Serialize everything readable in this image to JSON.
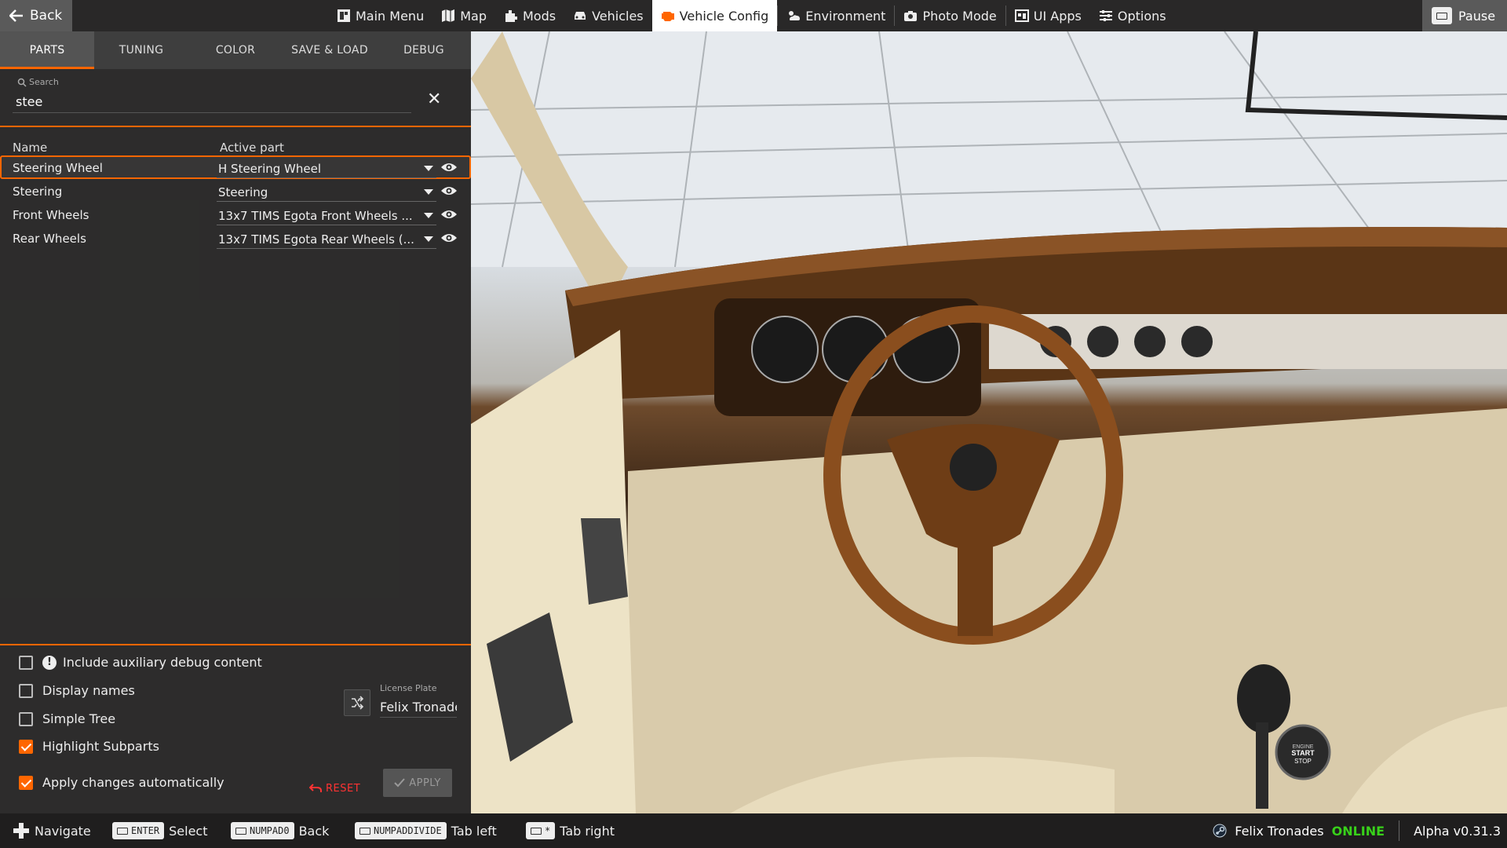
{
  "topbar": {
    "back_label": "Back",
    "nav": [
      {
        "label": "Main Menu",
        "icon": "main-menu-icon"
      },
      {
        "label": "Map",
        "icon": "map-icon"
      },
      {
        "label": "Mods",
        "icon": "mods-icon"
      },
      {
        "label": "Vehicles",
        "icon": "car-icon"
      },
      {
        "label": "Vehicle Config",
        "icon": "engine-icon",
        "active": true
      },
      {
        "label": "Environment",
        "icon": "weather-icon"
      },
      {
        "label": "Photo Mode",
        "icon": "camera-icon"
      },
      {
        "label": "UI Apps",
        "icon": "ui-apps-icon"
      },
      {
        "label": "Options",
        "icon": "sliders-icon"
      }
    ],
    "pause_label": "Pause"
  },
  "panel": {
    "tabs": [
      {
        "label": "PARTS",
        "active": true
      },
      {
        "label": "TUNING"
      },
      {
        "label": "COLOR"
      },
      {
        "label": "SAVE & LOAD"
      },
      {
        "label": "DEBUG"
      }
    ],
    "search": {
      "label": "Search",
      "value": "stee"
    },
    "columns": {
      "name": "Name",
      "active": "Active part"
    },
    "rows": [
      {
        "name": "Steering Wheel",
        "value": "H Steering Wheel",
        "selected": true
      },
      {
        "name": "Steering",
        "value": "Steering"
      },
      {
        "name": "Front Wheels",
        "value": "13x7 TIMS Egota Front Wheels ..."
      },
      {
        "name": "Rear Wheels",
        "value": "13x7 TIMS Egota Rear Wheels (..."
      }
    ],
    "settings": {
      "aux_debug": {
        "label": "Include auxiliary debug content",
        "checked": false
      },
      "display_names": {
        "label": "Display names",
        "checked": false
      },
      "simple_tree": {
        "label": "Simple Tree",
        "checked": false
      },
      "highlight_subparts": {
        "label": "Highlight Subparts",
        "checked": true
      },
      "apply_auto": {
        "label": "Apply changes automatically",
        "checked": true
      }
    },
    "license_plate": {
      "label": "License Plate",
      "value": "Felix Tronade"
    },
    "reset_label": "RESET",
    "apply_label": "APPLY"
  },
  "bottombar": {
    "hints": [
      {
        "key": "",
        "label": "Navigate"
      },
      {
        "key": "ENTER",
        "label": "Select"
      },
      {
        "key": "NUMPAD0",
        "label": "Back"
      },
      {
        "key": "NUMPADDIVIDE",
        "label": "Tab left"
      },
      {
        "key": "*",
        "label": "Tab right"
      }
    ],
    "user": "Felix Tronades",
    "status": "ONLINE",
    "version": "Alpha v0.31.3"
  },
  "scene": {
    "start_stop_lines": [
      "ENGINE",
      "START",
      "STOP"
    ]
  },
  "colors": {
    "accent": "#ff6600",
    "online": "#38d11a",
    "reset": "#ff3333"
  }
}
